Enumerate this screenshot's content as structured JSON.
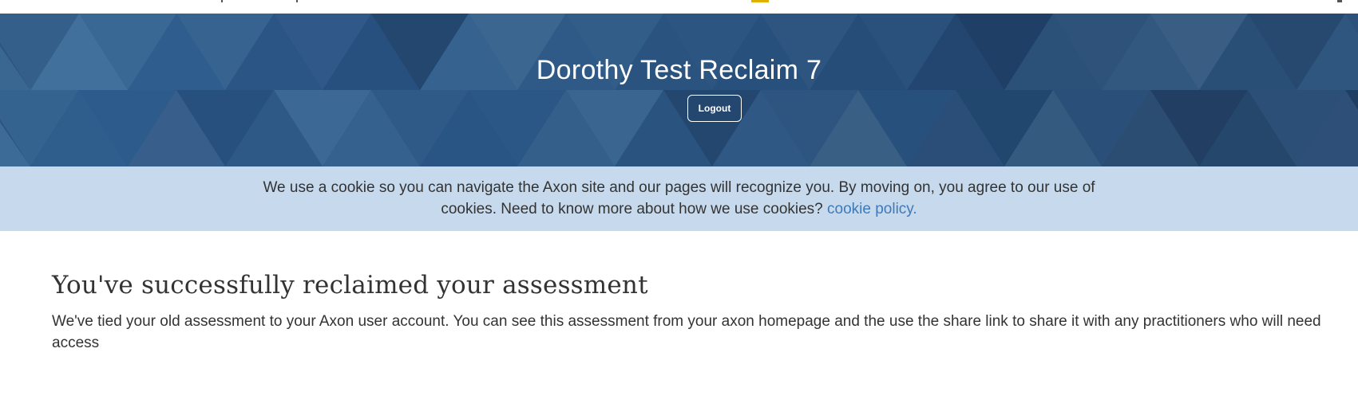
{
  "header": {
    "title": "Dorothy Test Reclaim 7",
    "logout_label": "Logout"
  },
  "cookie_banner": {
    "text": "We use a cookie so you can navigate the Axon site and our pages will recognize you. By moving on, you agree to our use of cookies. Need to know more about how we use cookies?",
    "link_label": "cookie policy."
  },
  "content": {
    "heading": "You've successfully reclaimed your assessment",
    "body": "We've tied your old assessment to your Axon user account. You can see this assessment from your axon homepage and the use the share link to share it with any practitioners who will need access"
  },
  "colors": {
    "hero_background": "#2d5580",
    "cookie_background": "#c7daed",
    "link": "#3e7ab8",
    "text": "#333333"
  }
}
